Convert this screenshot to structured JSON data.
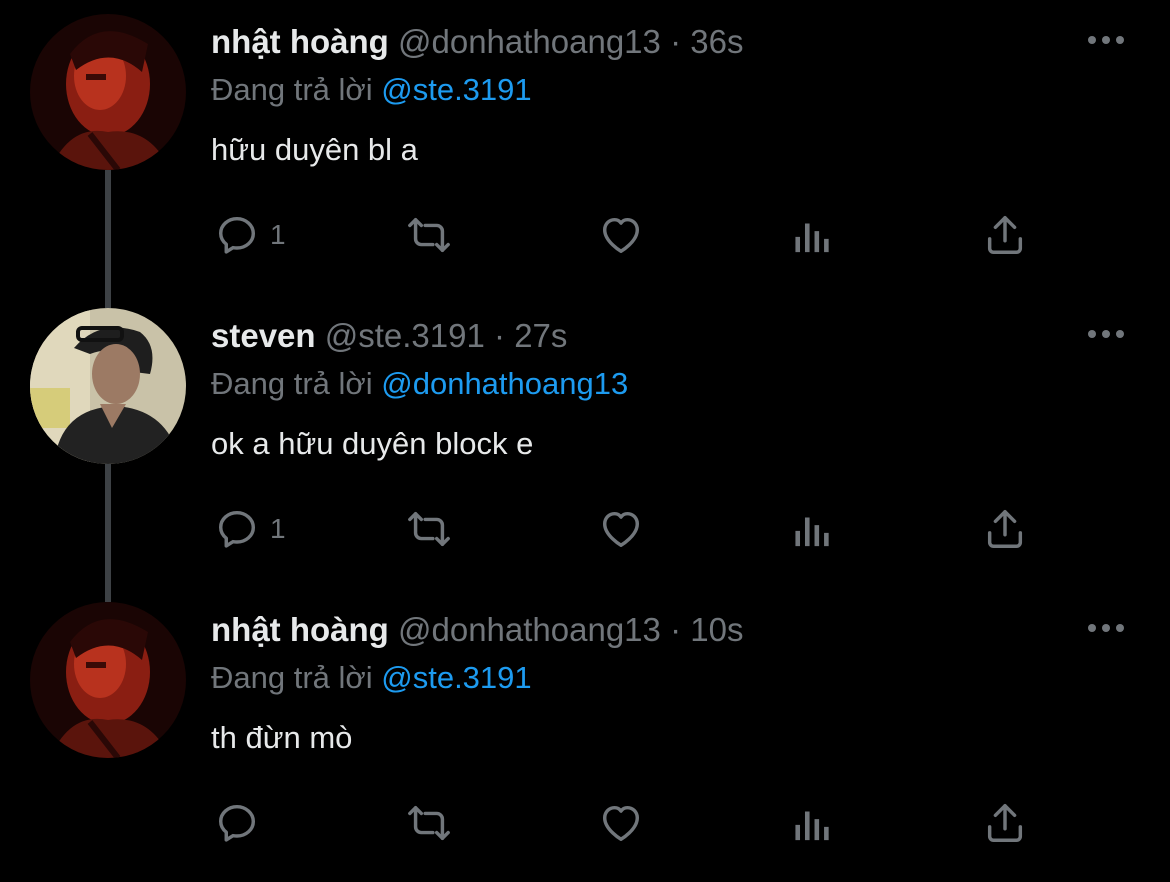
{
  "tweets": [
    {
      "author_name": "nhật hoàng",
      "handle": "@donhathoang13",
      "time": "36s",
      "reply_prefix": "Đang trả lời",
      "reply_to": "@ste.3191",
      "text": "hữu duyên bl a",
      "reply_count": "1",
      "avatar": "red-portrait"
    },
    {
      "author_name": "steven",
      "handle": "@ste.3191",
      "time": "27s",
      "reply_prefix": "Đang trả lời",
      "reply_to": "@donhathoang13",
      "text": "ok a hữu duyên block e",
      "reply_count": "1",
      "avatar": "glasses-portrait"
    },
    {
      "author_name": "nhật hoàng",
      "handle": "@donhathoang13",
      "time": "10s",
      "reply_prefix": "Đang trả lời",
      "reply_to": "@ste.3191",
      "text": "th đừn mò",
      "reply_count": "",
      "avatar": "red-portrait"
    }
  ],
  "separator": "·",
  "icons": {
    "more": "more-icon",
    "reply": "reply-icon",
    "retweet": "retweet-icon",
    "like": "heart-icon",
    "views": "views-icon",
    "share": "share-icon"
  },
  "colors": {
    "background": "#000000",
    "text": "#e7e9ea",
    "secondary": "#71767b",
    "accent": "#1d9bf0",
    "thread_line": "#3d4145"
  }
}
